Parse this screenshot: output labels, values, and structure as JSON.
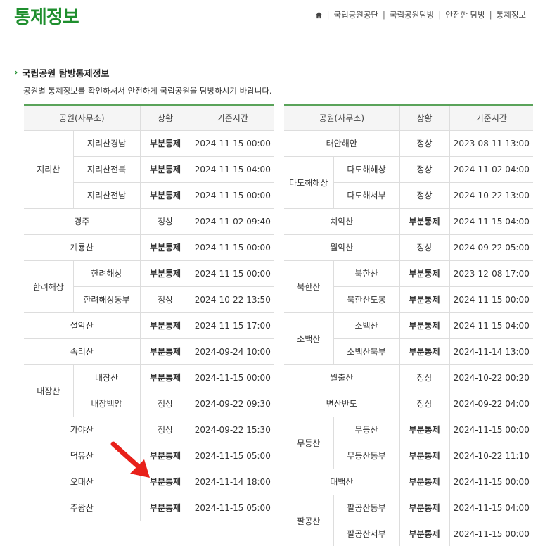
{
  "header": {
    "title": "통제정보",
    "breadcrumb": [
      "국립공원공단",
      "국립공원탐방",
      "안전한 탐방",
      "통제정보"
    ],
    "home_icon": "home-icon"
  },
  "section": {
    "title": "국립공원 탐방통제정보",
    "description": "공원별 통제정보를 확인하셔서 안전하게 국립공원을 탐방하시기 바랍니다."
  },
  "table_headers": {
    "park": "공원(사무소)",
    "status": "상황",
    "time": "기준시간"
  },
  "colors": {
    "brand_green": "#1f8f2e",
    "partial_status": "#c08a1e",
    "arrow": "#e8201a"
  },
  "left_table": [
    {
      "park": "지리산",
      "sub": "지리산경남",
      "status": "부분통제",
      "time": "2024-11-15 00:00"
    },
    {
      "park": "",
      "sub": "지리산전북",
      "status": "부분통제",
      "time": "2024-11-15 04:00"
    },
    {
      "park": "",
      "sub": "지리산전남",
      "status": "부분통제",
      "time": "2024-11-15 00:00"
    },
    {
      "park": "경주",
      "sub": "",
      "status": "정상",
      "time": "2024-11-02 09:40"
    },
    {
      "park": "계룡산",
      "sub": "",
      "status": "부분통제",
      "time": "2024-11-15 00:00"
    },
    {
      "park": "한려해상",
      "sub": "한려해상",
      "status": "부분통제",
      "time": "2024-11-15 00:00"
    },
    {
      "park": "",
      "sub": "한려해상동부",
      "status": "정상",
      "time": "2024-10-22 13:50"
    },
    {
      "park": "설악산",
      "sub": "",
      "status": "부분통제",
      "time": "2024-11-15 17:00"
    },
    {
      "park": "속리산",
      "sub": "",
      "status": "부분통제",
      "time": "2024-09-24 10:00"
    },
    {
      "park": "내장산",
      "sub": "내장산",
      "status": "부분통제",
      "time": "2024-11-15 00:00"
    },
    {
      "park": "",
      "sub": "내장백암",
      "status": "정상",
      "time": "2024-09-22 09:30"
    },
    {
      "park": "가야산",
      "sub": "",
      "status": "정상",
      "time": "2024-09-22 15:30"
    },
    {
      "park": "덕유산",
      "sub": "",
      "status": "부분통제",
      "time": "2024-11-15 05:00"
    },
    {
      "park": "오대산",
      "sub": "",
      "status": "부분통제",
      "time": "2024-11-14 18:00"
    },
    {
      "park": "주왕산",
      "sub": "",
      "status": "부분통제",
      "time": "2024-11-15 05:00"
    }
  ],
  "right_table": [
    {
      "park": "태안해안",
      "sub": "",
      "status": "정상",
      "time": "2023-08-11 13:00"
    },
    {
      "park": "다도해해상",
      "sub": "다도해해상",
      "status": "정상",
      "time": "2024-11-02 04:00"
    },
    {
      "park": "",
      "sub": "다도해서부",
      "status": "정상",
      "time": "2024-10-22 13:00"
    },
    {
      "park": "치악산",
      "sub": "",
      "status": "부분통제",
      "time": "2024-11-15 04:00"
    },
    {
      "park": "월악산",
      "sub": "",
      "status": "정상",
      "time": "2024-09-22 05:00"
    },
    {
      "park": "북한산",
      "sub": "북한산",
      "status": "부분통제",
      "time": "2023-12-08 17:00"
    },
    {
      "park": "",
      "sub": "북한산도봉",
      "status": "부분통제",
      "time": "2024-11-15 00:00"
    },
    {
      "park": "소백산",
      "sub": "소백산",
      "status": "부분통제",
      "time": "2024-11-15 04:00"
    },
    {
      "park": "",
      "sub": "소백산북부",
      "status": "부분통제",
      "time": "2024-11-14 13:00"
    },
    {
      "park": "월출산",
      "sub": "",
      "status": "정상",
      "time": "2024-10-22 00:20"
    },
    {
      "park": "변산반도",
      "sub": "",
      "status": "정상",
      "time": "2024-09-22 04:00"
    },
    {
      "park": "무등산",
      "sub": "무등산",
      "status": "부분통제",
      "time": "2024-11-15 00:00"
    },
    {
      "park": "",
      "sub": "무등산동부",
      "status": "부분통제",
      "time": "2024-10-22 11:10"
    },
    {
      "park": "태백산",
      "sub": "",
      "status": "부분통제",
      "time": "2024-11-15 00:00"
    },
    {
      "park": "팔공산",
      "sub": "팔공산동부",
      "status": "부분통제",
      "time": "2024-11-15 04:00"
    },
    {
      "park": "",
      "sub": "팔공산서부",
      "status": "부분통제",
      "time": "2024-11-15 00:00"
    }
  ]
}
